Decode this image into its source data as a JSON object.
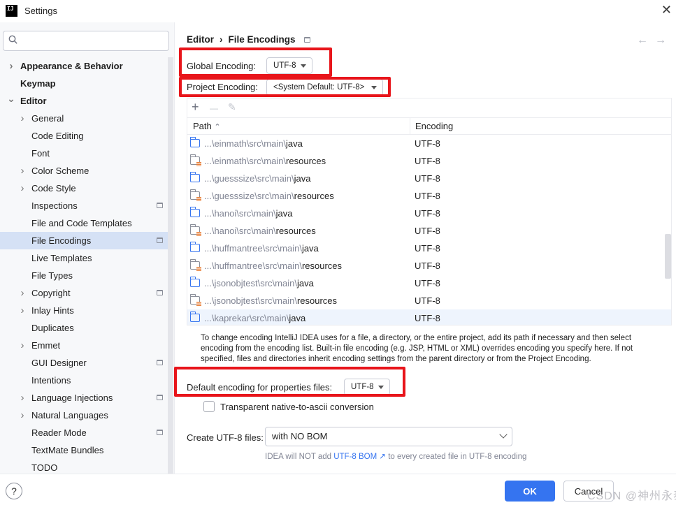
{
  "window": {
    "title": "Settings",
    "logo": "IJ"
  },
  "search": {
    "placeholder": ""
  },
  "sidebar": {
    "items": [
      {
        "label": "Appearance & Behavior",
        "bold": true,
        "chevron": "right",
        "level": 0,
        "page_icon": false
      },
      {
        "label": "Keymap",
        "bold": true,
        "chevron": "",
        "level": 0,
        "page_icon": false
      },
      {
        "label": "Editor",
        "bold": true,
        "chevron": "down",
        "level": 0,
        "page_icon": false
      },
      {
        "label": "General",
        "bold": false,
        "chevron": "right",
        "level": 1,
        "page_icon": false
      },
      {
        "label": "Code Editing",
        "bold": false,
        "chevron": "",
        "level": 1,
        "page_icon": false
      },
      {
        "label": "Font",
        "bold": false,
        "chevron": "",
        "level": 1,
        "page_icon": false
      },
      {
        "label": "Color Scheme",
        "bold": false,
        "chevron": "right",
        "level": 1,
        "page_icon": false
      },
      {
        "label": "Code Style",
        "bold": false,
        "chevron": "right",
        "level": 1,
        "page_icon": false
      },
      {
        "label": "Inspections",
        "bold": false,
        "chevron": "",
        "level": 1,
        "page_icon": true
      },
      {
        "label": "File and Code Templates",
        "bold": false,
        "chevron": "",
        "level": 1,
        "page_icon": false
      },
      {
        "label": "File Encodings",
        "bold": false,
        "chevron": "",
        "level": 1,
        "page_icon": true,
        "selected": true
      },
      {
        "label": "Live Templates",
        "bold": false,
        "chevron": "",
        "level": 1,
        "page_icon": false
      },
      {
        "label": "File Types",
        "bold": false,
        "chevron": "",
        "level": 1,
        "page_icon": false
      },
      {
        "label": "Copyright",
        "bold": false,
        "chevron": "right",
        "level": 1,
        "page_icon": true
      },
      {
        "label": "Inlay Hints",
        "bold": false,
        "chevron": "right",
        "level": 1,
        "page_icon": false
      },
      {
        "label": "Duplicates",
        "bold": false,
        "chevron": "",
        "level": 1,
        "page_icon": false
      },
      {
        "label": "Emmet",
        "bold": false,
        "chevron": "right",
        "level": 1,
        "page_icon": false
      },
      {
        "label": "GUI Designer",
        "bold": false,
        "chevron": "",
        "level": 1,
        "page_icon": true
      },
      {
        "label": "Intentions",
        "bold": false,
        "chevron": "",
        "level": 1,
        "page_icon": false
      },
      {
        "label": "Language Injections",
        "bold": false,
        "chevron": "right",
        "level": 1,
        "page_icon": true
      },
      {
        "label": "Natural Languages",
        "bold": false,
        "chevron": "right",
        "level": 1,
        "page_icon": false
      },
      {
        "label": "Reader Mode",
        "bold": false,
        "chevron": "",
        "level": 1,
        "page_icon": true
      },
      {
        "label": "TextMate Bundles",
        "bold": false,
        "chevron": "",
        "level": 1,
        "page_icon": false
      },
      {
        "label": "TODO",
        "bold": false,
        "chevron": "",
        "level": 1,
        "page_icon": false
      }
    ]
  },
  "breadcrumb": {
    "parent": "Editor",
    "sep": "›",
    "current": "File Encodings"
  },
  "nav": {
    "back": "←",
    "forward": "→"
  },
  "global_encoding": {
    "label": "Global Encoding:",
    "value": "UTF-8"
  },
  "project_encoding": {
    "label": "Project Encoding:",
    "value": "<System Default: UTF-8>"
  },
  "toolbar": {
    "add": "+",
    "remove": "—",
    "edit": "✎"
  },
  "table": {
    "columns": {
      "path": "Path",
      "sort_arrow": "⌃",
      "encoding": "Encoding"
    },
    "rows": [
      {
        "prefix": "...\\einmath\\src\\main\\",
        "leaf": "java",
        "type": "source",
        "encoding": "UTF-8"
      },
      {
        "prefix": "...\\einmath\\src\\main\\",
        "leaf": "resources",
        "type": "resources",
        "encoding": "UTF-8"
      },
      {
        "prefix": "...\\guesssize\\src\\main\\",
        "leaf": "java",
        "type": "source",
        "encoding": "UTF-8"
      },
      {
        "prefix": "...\\guesssize\\src\\main\\",
        "leaf": "resources",
        "type": "resources",
        "encoding": "UTF-8"
      },
      {
        "prefix": "...\\hanoi\\src\\main\\",
        "leaf": "java",
        "type": "source",
        "encoding": "UTF-8"
      },
      {
        "prefix": "...\\hanoi\\src\\main\\",
        "leaf": "resources",
        "type": "resources",
        "encoding": "UTF-8"
      },
      {
        "prefix": "...\\huffmantree\\src\\main\\",
        "leaf": "java",
        "type": "source",
        "encoding": "UTF-8"
      },
      {
        "prefix": "...\\huffmantree\\src\\main\\",
        "leaf": "resources",
        "type": "resources",
        "encoding": "UTF-8"
      },
      {
        "prefix": "...\\jsonobjtest\\src\\main\\",
        "leaf": "java",
        "type": "source",
        "encoding": "UTF-8"
      },
      {
        "prefix": "...\\jsonobjtest\\src\\main\\",
        "leaf": "resources",
        "type": "resources",
        "encoding": "UTF-8"
      },
      {
        "prefix": "...\\kaprekar\\src\\main\\",
        "leaf": "java",
        "type": "source",
        "encoding": "UTF-8"
      }
    ]
  },
  "info_text": "To change encoding IntelliJ IDEA uses for a file, a directory, or the entire project, add its path if necessary and then select encoding from the encoding list. Built-in file encoding (e.g. JSP, HTML or XML) overrides encoding you specify here. If not specified, files and directories inherit encoding settings from the parent directory or from the Project Encoding.",
  "properties_encoding": {
    "label": "Default encoding for properties files:",
    "value": "UTF-8"
  },
  "native_to_ascii": {
    "label": "Transparent native-to-ascii conversion",
    "checked": false
  },
  "create_utf8": {
    "label": "Create UTF-8 files:",
    "value": "with NO BOM"
  },
  "hint": {
    "before": "IDEA will NOT add ",
    "link": "UTF-8 BOM ↗",
    "after": " to every created file in UTF-8 encoding"
  },
  "footer": {
    "help": "?",
    "ok": "OK",
    "cancel": "Cancel",
    "watermark": "CSDN @神州永泰"
  },
  "colors": {
    "accent": "#3574f0",
    "highlight_box": "#e8151b",
    "selected_row": "#d5e1f5"
  }
}
